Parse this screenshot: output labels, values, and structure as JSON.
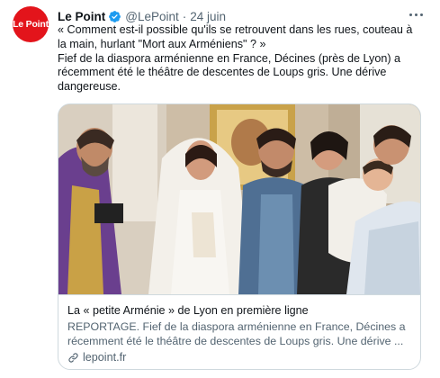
{
  "tweet": {
    "avatar_text": "Le Point",
    "author_name": "Le Point",
    "handle": "@LePoint",
    "separator": "·",
    "date": "24 juin",
    "text_line1": "« Comment est-il possible qu'ils se retrouvent dans les rues, couteau à la main, hurlant \"Mort aux Arméniens\" ? »",
    "text_line2": "Fief de la diaspora arménienne en France, Décines (près de Lyon) a récemment été le théâtre de descentes de Loups gris. Une dérive dangereuse."
  },
  "card": {
    "title": "La « petite Arménie » de Lyon en première ligne",
    "description": "REPORTAGE. Fief de la diaspora arménienne en France, Décines a récemment été le théâtre de descentes de Loups gris. Une dérive ...",
    "domain": "lepoint.fr"
  },
  "icons": {
    "verified": "verified-badge-icon",
    "more": "more-options-icon",
    "link": "link-icon"
  },
  "colors": {
    "brand_red": "#e3141b",
    "verified_blue": "#1d9bf0",
    "secondary_text": "#536471",
    "border": "#cfd9de"
  }
}
